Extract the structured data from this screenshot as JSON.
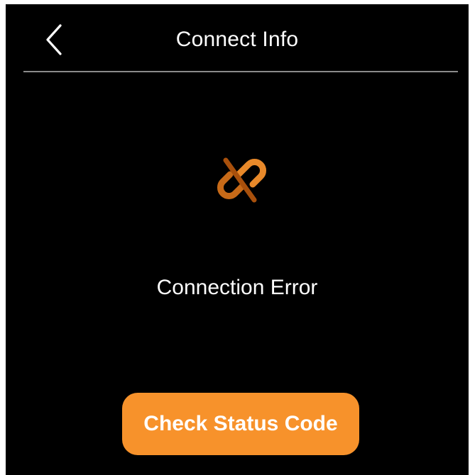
{
  "header": {
    "title": "Connect Info",
    "back_icon": "chevron-left-icon"
  },
  "status": {
    "icon": "broken-link-icon",
    "message": "Connection Error"
  },
  "actions": {
    "check_status_label": "Check Status Code"
  },
  "colors": {
    "background": "#000000",
    "accent": "#F7922B",
    "icon_dark": "#B85A10",
    "icon_light": "#E8892A",
    "divider": "#8A8A8A",
    "text": "#FFFFFF"
  }
}
